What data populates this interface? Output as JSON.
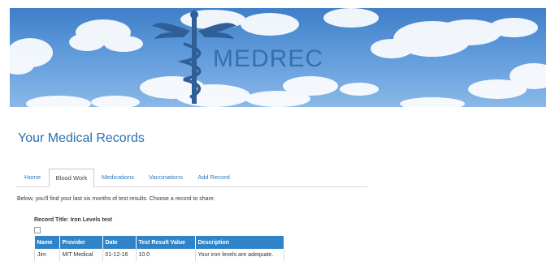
{
  "app": {
    "name": "MEDREC"
  },
  "header": {
    "page_title": "Your Medical Records"
  },
  "tabs": [
    {
      "label": "Home",
      "active": false
    },
    {
      "label": "Blood Work",
      "active": true
    },
    {
      "label": "Medications",
      "active": false
    },
    {
      "label": "Vaccinations",
      "active": false
    },
    {
      "label": "Add Record",
      "active": false
    }
  ],
  "content": {
    "intro": "Below, you'll find your last six months of test results. Choose a record to share.",
    "record_title": "Record Title: Iron Levels test"
  },
  "table": {
    "columns": [
      "Name",
      "Provider",
      "Date",
      "Test Result Value",
      "Description"
    ],
    "rows": [
      [
        "Jim",
        "MIT Medical",
        "01-12-16",
        "10.0",
        "Your iron levels are adequate."
      ]
    ]
  },
  "colors": {
    "accent": "#2b6fb4",
    "table_header": "#2f83c6",
    "logo": "#3a6ea8"
  },
  "icons": {
    "logo": "caduceus-icon"
  }
}
